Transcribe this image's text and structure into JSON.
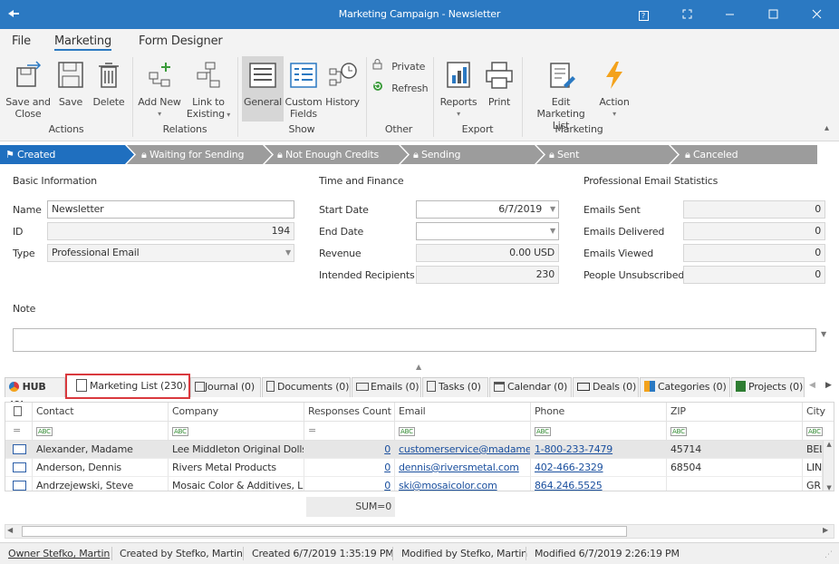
{
  "window": {
    "title": "Marketing Campaign - Newsletter",
    "help_icon": "?",
    "accent": "#2b79c2"
  },
  "menu": {
    "file": "File",
    "marketing": "Marketing",
    "form_designer": "Form Designer"
  },
  "ribbon": {
    "save_close": [
      "Save and",
      "Close"
    ],
    "save": "Save",
    "delete": "Delete",
    "group_actions": "Actions",
    "add_new": "Add New",
    "link_existing": [
      "Link to",
      "Existing"
    ],
    "group_relations": "Relations",
    "general": "General",
    "custom_fields": [
      "Custom",
      "Fields"
    ],
    "history": "History",
    "group_show": "Show",
    "private": "Private",
    "refresh": "Refresh",
    "group_other": "Other",
    "reports": "Reports",
    "print": "Print",
    "group_export": "Export",
    "edit_marketing_list": [
      "Edit Marketing",
      "List"
    ],
    "action": "Action",
    "group_marketing": "Marketing"
  },
  "stages": [
    {
      "label": "Created",
      "active": true
    },
    {
      "label": "Waiting for Sending",
      "active": false
    },
    {
      "label": "Not Enough Credits",
      "active": false
    },
    {
      "label": "Sending",
      "active": false
    },
    {
      "label": "Sent",
      "active": false
    },
    {
      "label": "Canceled",
      "active": false
    }
  ],
  "basic": {
    "header": "Basic Information",
    "name_label": "Name",
    "name_value": "Newsletter",
    "id_label": "ID",
    "id_value": "194",
    "type_label": "Type",
    "type_value": "Professional Email"
  },
  "finance": {
    "header": "Time and Finance",
    "start_label": "Start Date",
    "start_value": "6/7/2019",
    "end_label": "End Date",
    "end_value": "",
    "revenue_label": "Revenue",
    "revenue_value": "0.00 USD",
    "recipients_label": "Intended Recipients",
    "recipients_value": "230"
  },
  "stats": {
    "header": "Professional Email Statistics",
    "sent_label": "Emails Sent",
    "sent_value": "0",
    "delivered_label": "Emails Delivered",
    "delivered_value": "0",
    "viewed_label": "Emails Viewed",
    "viewed_value": "0",
    "unsub_label": "People Unsubscribed",
    "unsub_value": "0"
  },
  "note": {
    "label": "Note",
    "value": ""
  },
  "tabs": [
    {
      "label": "HUB (0)",
      "icon": "hub-icon"
    },
    {
      "label": "Marketing List (230)",
      "icon": "marketing-list-icon"
    },
    {
      "label": "Journal (0)",
      "icon": "journal-icon"
    },
    {
      "label": "Documents (0)",
      "icon": "document-icon"
    },
    {
      "label": "Emails (0)",
      "icon": "email-icon"
    },
    {
      "label": "Tasks (0)",
      "icon": "task-icon"
    },
    {
      "label": "Calendar (0)",
      "icon": "calendar-icon"
    },
    {
      "label": "Deals (0)",
      "icon": "deal-icon"
    },
    {
      "label": "Categories (0)",
      "icon": "categories-icon"
    },
    {
      "label": "Projects (0)",
      "icon": "project-icon"
    }
  ],
  "grid": {
    "columns": [
      "Contact",
      "Company",
      "Responses Count",
      "Email",
      "Phone",
      "ZIP",
      "City"
    ],
    "filter_abc": "ABC",
    "filter_eq": "=",
    "rows": [
      {
        "contact": "Alexander, Madame",
        "company": "Lee Middleton Original Dolls ...",
        "responses": "0",
        "email": "customerservice@madamea...",
        "phone": "1-800-233-7479",
        "zip": "45714",
        "city": "BEL"
      },
      {
        "contact": "Anderson, Dennis",
        "company": "Rivers Metal Products",
        "responses": "0",
        "email": "dennis@riversmetal.com",
        "phone": "402-466-2329",
        "zip": "68504",
        "city": "LIN"
      },
      {
        "contact": "Andrzejewski, Steve",
        "company": "Mosaic Color & Additives, LLC",
        "responses": "0",
        "email": "ski@mosaicolor.com",
        "phone": "864.246.5525",
        "zip": "",
        "city": "GR"
      }
    ],
    "sum": "SUM=0"
  },
  "status": {
    "owner": "Owner Stefko, Martin",
    "created_by": "Created by Stefko, Martin",
    "created": "Created 6/7/2019 1:35:19 PM",
    "modified_by": "Modified by Stefko, Martin",
    "modified": "Modified 6/7/2019 2:26:19 PM"
  }
}
